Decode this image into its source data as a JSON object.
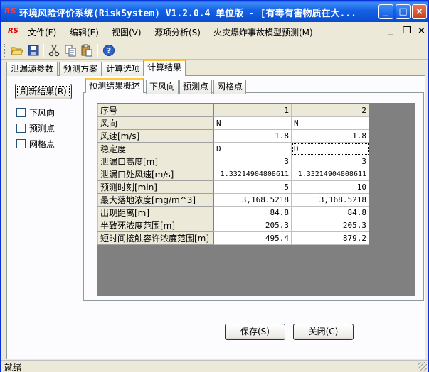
{
  "window": {
    "title": "环境风险评价系统(RiskSystem) V1.2.0.4 单位版 - [有毒有害物质在大...",
    "logo_text": "RS",
    "controls": {
      "minimize": "_",
      "maximize": "□",
      "close": "×"
    }
  },
  "menu": {
    "logo_text": "RS",
    "items": [
      "文件(F)",
      "编辑(E)",
      "视图(V)",
      "源项分析(S)",
      "火灾爆炸事故模型预测(M)"
    ],
    "mdi_controls": {
      "minimize": "_",
      "restore": "❐",
      "close": "×"
    }
  },
  "toolbar": {
    "icons": [
      "open-folder-icon",
      "save-icon",
      "cut-icon",
      "copy-icon",
      "paste-icon",
      "help-icon"
    ]
  },
  "outer_tabs": [
    "泄漏源参数",
    "预测方案",
    "计算选项",
    "计算结果"
  ],
  "left_panel": {
    "refresh_label": "刷新结果(R)",
    "checkboxes": [
      "下风向",
      "预测点",
      "网格点"
    ]
  },
  "inner_tabs": [
    "预测结果概述",
    "下风向",
    "预测点",
    "网格点"
  ],
  "grid": {
    "header_label": "序号",
    "columns": [
      "1",
      "2"
    ],
    "rows": [
      {
        "label": "风向",
        "values": [
          "N",
          "N"
        ]
      },
      {
        "label": "风速[m/s]",
        "values": [
          "1.8",
          "1.8"
        ]
      },
      {
        "label": "稳定度",
        "values": [
          "D",
          "D"
        ]
      },
      {
        "label": "泄漏口高度[m]",
        "values": [
          "3",
          "3"
        ]
      },
      {
        "label": "泄漏口处风速[m/s]",
        "values": [
          "1.33214904808611",
          "1.33214904808611"
        ]
      },
      {
        "label": "预测时刻[min]",
        "values": [
          "5",
          "10"
        ]
      },
      {
        "label": "最大落地浓度[mg/m^3]",
        "values": [
          "3,168.5218",
          "3,168.5218"
        ]
      },
      {
        "label": "出现距离[m]",
        "values": [
          "84.8",
          "84.8"
        ]
      },
      {
        "label": "半致死浓度范围[m]",
        "values": [
          "205.3",
          "205.3"
        ]
      },
      {
        "label": "短时间接触容许浓度范围[m]",
        "values": [
          "495.4",
          "879.2"
        ]
      }
    ]
  },
  "buttons": {
    "save": "保存(S)",
    "close": "关闭(C)"
  },
  "status": {
    "text": "就绪"
  }
}
